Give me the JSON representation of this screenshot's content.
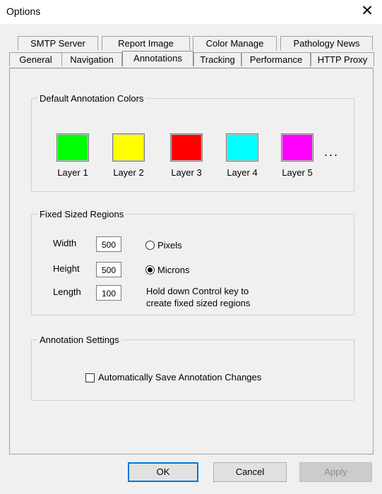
{
  "window": {
    "title": "Options",
    "close_glyph": "✕"
  },
  "tabs": {
    "row1": [
      "SMTP Server",
      "Report Image",
      "Color Manage",
      "Pathology News"
    ],
    "row2": [
      "General",
      "Navigation",
      "Annotations",
      "Tracking",
      "Performance",
      "HTTP Proxy"
    ],
    "active": "Annotations"
  },
  "default_colors": {
    "legend": "Default Annotation Colors",
    "layers": [
      {
        "label": "Layer 1",
        "color": "#00ff00"
      },
      {
        "label": "Layer 2",
        "color": "#ffff00"
      },
      {
        "label": "Layer 3",
        "color": "#ff0000"
      },
      {
        "label": "Layer 4",
        "color": "#00ffff"
      },
      {
        "label": "Layer 5",
        "color": "#ff00ff"
      }
    ],
    "more": "..."
  },
  "fixed_regions": {
    "legend": "Fixed Sized Regions",
    "width_label": "Width",
    "width_value": "500",
    "height_label": "Height",
    "height_value": "500",
    "length_label": "Length",
    "length_value": "100",
    "unit_pixels": "Pixels",
    "unit_microns": "Microns",
    "selected_unit": "Microns",
    "hint_line1": "Hold down Control key to",
    "hint_line2": "create fixed sized regions"
  },
  "annotation_settings": {
    "legend": "Annotation Settings",
    "auto_save_label": "Automatically Save Annotation Changes",
    "auto_save_checked": false
  },
  "buttons": {
    "ok": "OK",
    "cancel": "Cancel",
    "apply": "Apply"
  }
}
